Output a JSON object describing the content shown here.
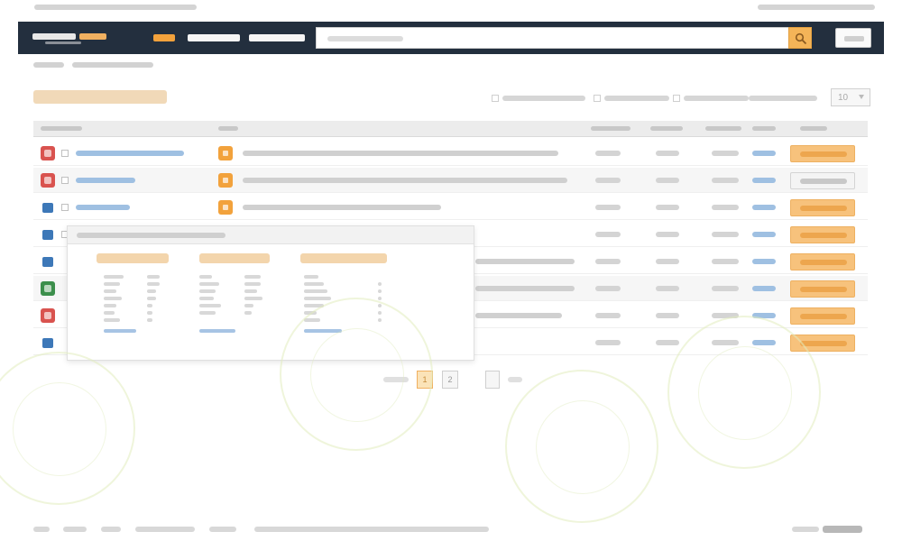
{
  "topbar": {
    "welcome_text": "",
    "account_links": ""
  },
  "header": {
    "logo_text": "",
    "nav": [
      {
        "label": "",
        "active": true
      },
      {
        "label": "",
        "active": false
      },
      {
        "label": "",
        "active": false
      }
    ],
    "search_placeholder": "",
    "search_button": "search-icon",
    "right_button": ""
  },
  "breadcrumb": [
    "",
    ""
  ],
  "page_title": "",
  "filters": [
    "",
    "",
    ""
  ],
  "per_page": {
    "label": "",
    "value": "10"
  },
  "table": {
    "columns": [
      "",
      "",
      "",
      "",
      "",
      "",
      ""
    ],
    "rows": [
      {
        "icon": "red",
        "requester": "",
        "title": "",
        "hits": "",
        "reward": "",
        "time": "",
        "preview": "",
        "action": ""
      },
      {
        "icon": "red",
        "requester": "",
        "title": "",
        "hits": "",
        "reward": "",
        "time": "",
        "preview": "",
        "action": ""
      },
      {
        "icon": "blue",
        "requester": "",
        "title": "",
        "hits": "",
        "reward": "",
        "time": "",
        "preview": "",
        "action": ""
      },
      {
        "icon": "blue",
        "requester": "",
        "title": "",
        "hits": "",
        "reward": "",
        "time": "",
        "preview": "",
        "action": ""
      },
      {
        "icon": "blue",
        "requester": "",
        "title": "",
        "hits": "",
        "reward": "",
        "time": "",
        "preview": "",
        "action": ""
      },
      {
        "icon": "green",
        "requester": "",
        "title": "",
        "hits": "",
        "reward": "",
        "time": "",
        "preview": "",
        "action": ""
      },
      {
        "icon": "red",
        "requester": "",
        "title": "",
        "hits": "",
        "reward": "",
        "time": "",
        "preview": "",
        "action": ""
      },
      {
        "icon": "blue",
        "requester": "",
        "title": "",
        "hits": "",
        "reward": "",
        "time": "",
        "preview": "",
        "action": ""
      }
    ]
  },
  "popup": {
    "title": "",
    "columns": [
      {
        "heading": "",
        "link": ""
      },
      {
        "heading": "",
        "link": ""
      },
      {
        "heading": "",
        "link": ""
      }
    ]
  },
  "pagination": {
    "prev": "",
    "pages": [
      "1",
      "2"
    ],
    "next": "",
    "current": "1"
  },
  "footer": {
    "links": [
      "",
      "",
      "",
      "",
      "",
      ""
    ],
    "brand": ""
  },
  "colors": {
    "header_bg": "#232f3e",
    "accent": "#f2a23c",
    "link": "#9fc0e2"
  }
}
